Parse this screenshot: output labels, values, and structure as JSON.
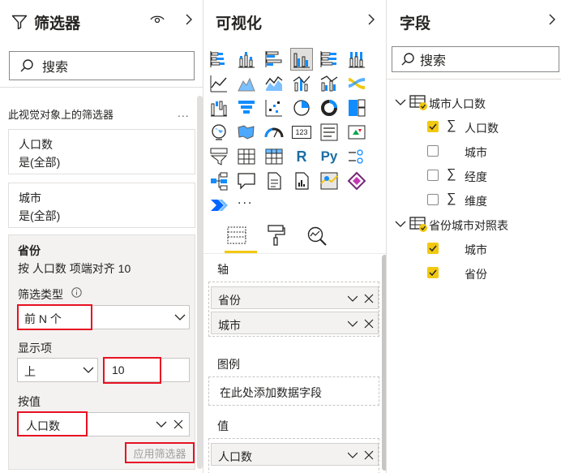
{
  "filters": {
    "title": "筛选器",
    "search_placeholder": "搜索",
    "section_caption": "此视觉对象上的筛选器",
    "more": "...",
    "cards": [
      {
        "name": "人口数",
        "value": "是(全部)"
      },
      {
        "name": "城市",
        "value": "是(全部)"
      }
    ],
    "expanded": {
      "name": "省份",
      "summary": "按 人口数 项端对齐 10",
      "filter_type_label": "筛选类型",
      "filter_type_value": "前 N 个",
      "show_items_label": "显示项",
      "direction_value": "上",
      "count_value": "10",
      "by_value_label": "按值",
      "by_value_field": "人口数",
      "apply_button": "应用筛选器"
    }
  },
  "visualizations": {
    "title": "可视化",
    "more": "...",
    "wells": {
      "axis_title": "轴",
      "axis_fields": [
        "省份",
        "城市"
      ],
      "legend_title": "图例",
      "legend_placeholder": "在此处添加数据字段",
      "values_title": "值",
      "values_fields": [
        "人口数"
      ]
    },
    "letter_icons": {
      "r": "R",
      "py": "Py",
      "num": "123"
    }
  },
  "fields": {
    "title": "字段",
    "search_placeholder": "搜索",
    "tables": [
      {
        "name": "城市人口数",
        "items": [
          {
            "label": "人口数",
            "checked": true,
            "sigma": true
          },
          {
            "label": "城市",
            "checked": false,
            "sigma": false
          },
          {
            "label": "经度",
            "checked": false,
            "sigma": true
          },
          {
            "label": "维度",
            "checked": false,
            "sigma": true
          }
        ]
      },
      {
        "name": "省份城市对照表",
        "items": [
          {
            "label": "城市",
            "checked": true,
            "sigma": false
          },
          {
            "label": "省份",
            "checked": true,
            "sigma": false
          }
        ]
      }
    ],
    "sigma_symbol": "∑"
  },
  "colors": {
    "accent": "#f2c811",
    "highlight_border": "#e81123",
    "panel_bg": "#f3f2f1"
  }
}
